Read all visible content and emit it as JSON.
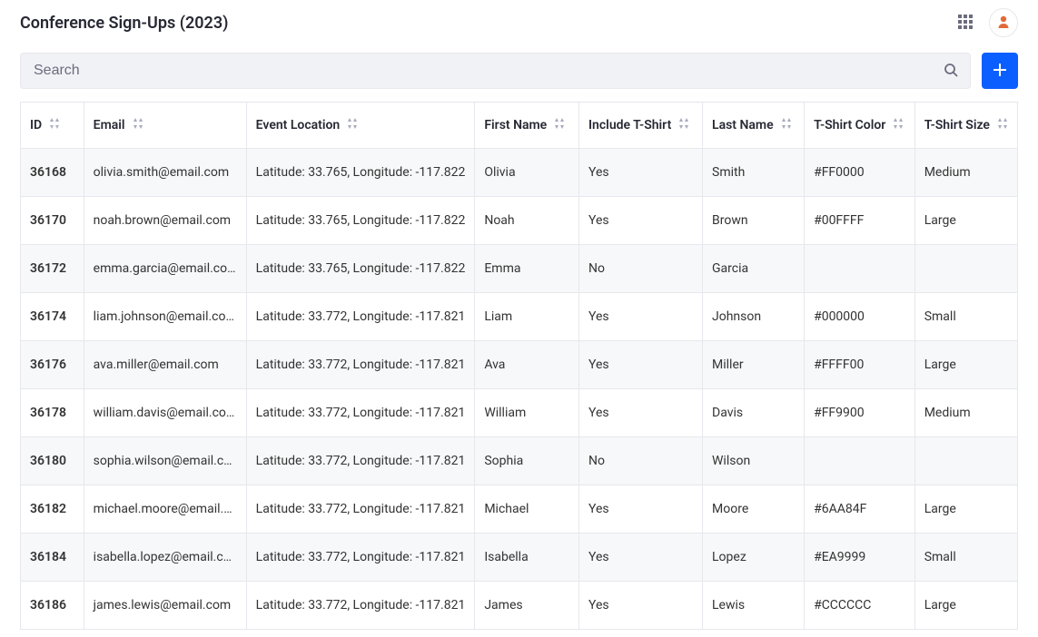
{
  "header": {
    "title": "Conference Sign-Ups (2023)"
  },
  "search": {
    "placeholder": "Search",
    "value": ""
  },
  "table": {
    "columns": [
      {
        "key": "id",
        "label": "ID"
      },
      {
        "key": "email",
        "label": "Email"
      },
      {
        "key": "event_location",
        "label": "Event Location"
      },
      {
        "key": "first_name",
        "label": "First Name"
      },
      {
        "key": "include_tshirt",
        "label": "Include T-Shirt"
      },
      {
        "key": "last_name",
        "label": "Last Name"
      },
      {
        "key": "tshirt_color",
        "label": "T-Shirt Color"
      },
      {
        "key": "tshirt_size",
        "label": "T-Shirt Size"
      }
    ],
    "rows": [
      {
        "id": "36168",
        "email": "olivia.smith@email.com",
        "event_location": "Latitude: 33.765, Longitude: -117.822",
        "first_name": "Olivia",
        "include_tshirt": "Yes",
        "last_name": "Smith",
        "tshirt_color": "#FF0000",
        "tshirt_size": "Medium"
      },
      {
        "id": "36170",
        "email": "noah.brown@email.com",
        "event_location": "Latitude: 33.765, Longitude: -117.822",
        "first_name": "Noah",
        "include_tshirt": "Yes",
        "last_name": "Brown",
        "tshirt_color": "#00FFFF",
        "tshirt_size": "Large"
      },
      {
        "id": "36172",
        "email": "emma.garcia@email.com",
        "event_location": "Latitude: 33.765, Longitude: -117.822",
        "first_name": "Emma",
        "include_tshirt": "No",
        "last_name": "Garcia",
        "tshirt_color": "",
        "tshirt_size": ""
      },
      {
        "id": "36174",
        "email": "liam.johnson@email.com",
        "event_location": "Latitude: 33.772, Longitude: -117.821",
        "first_name": "Liam",
        "include_tshirt": "Yes",
        "last_name": "Johnson",
        "tshirt_color": "#000000",
        "tshirt_size": "Small"
      },
      {
        "id": "36176",
        "email": "ava.miller@email.com",
        "event_location": "Latitude: 33.772, Longitude: -117.821",
        "first_name": "Ava",
        "include_tshirt": "Yes",
        "last_name": "Miller",
        "tshirt_color": "#FFFF00",
        "tshirt_size": "Large"
      },
      {
        "id": "36178",
        "email": "william.davis@email.com",
        "event_location": "Latitude: 33.772, Longitude: -117.821",
        "first_name": "William",
        "include_tshirt": "Yes",
        "last_name": "Davis",
        "tshirt_color": "#FF9900",
        "tshirt_size": "Medium"
      },
      {
        "id": "36180",
        "email": "sophia.wilson@email.com",
        "event_location": "Latitude: 33.772, Longitude: -117.821",
        "first_name": "Sophia",
        "include_tshirt": "No",
        "last_name": "Wilson",
        "tshirt_color": "",
        "tshirt_size": ""
      },
      {
        "id": "36182",
        "email": "michael.moore@email.com",
        "event_location": "Latitude: 33.772, Longitude: -117.821",
        "first_name": "Michael",
        "include_tshirt": "Yes",
        "last_name": "Moore",
        "tshirt_color": "#6AA84F",
        "tshirt_size": "Large",
        "email_truncated": "michael.moore@email.c..."
      },
      {
        "id": "36184",
        "email": "isabella.lopez@email.com",
        "event_location": "Latitude: 33.772, Longitude: -117.821",
        "first_name": "Isabella",
        "include_tshirt": "Yes",
        "last_name": "Lopez",
        "tshirt_color": "#EA9999",
        "tshirt_size": "Small"
      },
      {
        "id": "36186",
        "email": "james.lewis@email.com",
        "event_location": "Latitude: 33.772, Longitude: -117.821",
        "first_name": "James",
        "include_tshirt": "Yes",
        "last_name": "Lewis",
        "tshirt_color": "#CCCCCC",
        "tshirt_size": "Large"
      }
    ]
  }
}
